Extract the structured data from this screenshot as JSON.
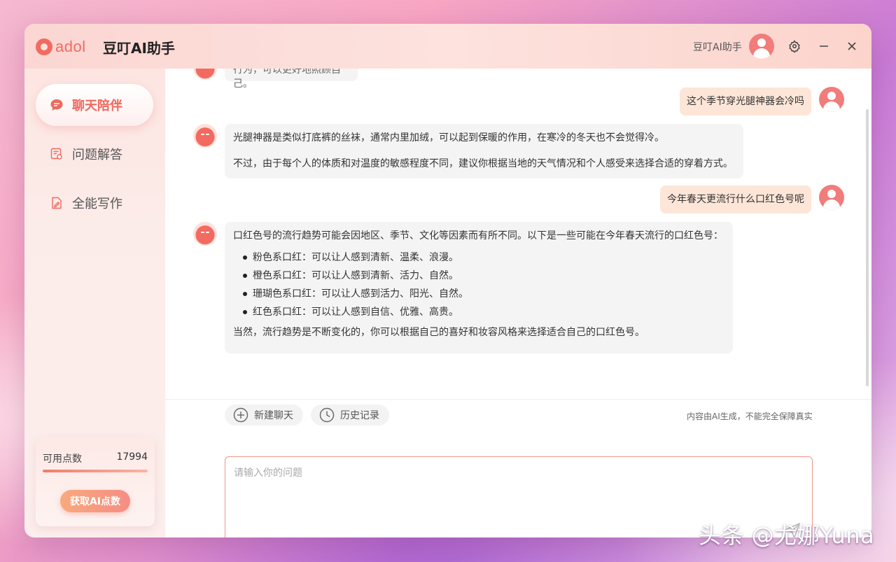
{
  "app": {
    "logo_text": "adol",
    "title": "豆叮AI助手",
    "user_name": "豆叮AI助手"
  },
  "sidebar": {
    "items": [
      {
        "label": "聊天陪伴",
        "icon": "chat-bubble-icon",
        "active": true
      },
      {
        "label": "问题解答",
        "icon": "document-question-icon",
        "active": false
      },
      {
        "label": "全能写作",
        "icon": "pen-document-icon",
        "active": false
      }
    ],
    "points": {
      "label": "可用点数",
      "value": "17994",
      "fill_fraction": 1.0,
      "button_label": "获取AI点数"
    }
  },
  "chat": {
    "partial_top": "行为，可以更好地照顾自己。",
    "messages": [
      {
        "role": "user",
        "text": "这个季节穿光腿神器会冷吗"
      },
      {
        "role": "bot",
        "paragraphs": [
          "光腿神器是类似打底裤的丝袜，通常内里加绒，可以起到保暖的作用，在寒冷的冬天也不会觉得冷。",
          "不过，由于每个人的体质和对温度的敏感程度不同，建议你根据当地的天气情况和个人感受来选择合适的穿着方式。"
        ]
      },
      {
        "role": "user",
        "text": "今年春天更流行什么口红色号呢"
      },
      {
        "role": "bot",
        "intro": "口红色号的流行趋势可能会因地区、季节、文化等因素而有所不同。以下是一些可能在今年春天流行的口红色号：",
        "bullets": [
          "粉色系口红：可以让人感到清新、温柔、浪漫。",
          "橙色系口红：可以让人感到清新、活力、自然。",
          "珊瑚色系口红：可以让人感到活力、阳光、自然。",
          "红色系口红：可以让人感到自信、优雅、高贵。"
        ],
        "outro": "当然，流行趋势是不断变化的，你可以根据自己的喜好和妆容风格来选择适合自己的口红色号。"
      }
    ]
  },
  "toolbar": {
    "new_chat": "新建聊天",
    "history": "历史记录",
    "disclaimer": "内容由AI生成，不能完全保障真实"
  },
  "input": {
    "placeholder": "请输入你的问题"
  },
  "watermark": "头条 @尤娜Yuna",
  "colors": {
    "accent": "#f0685d",
    "user_bubble": "#fde6d8",
    "bot_bubble": "#f4f4f4"
  }
}
